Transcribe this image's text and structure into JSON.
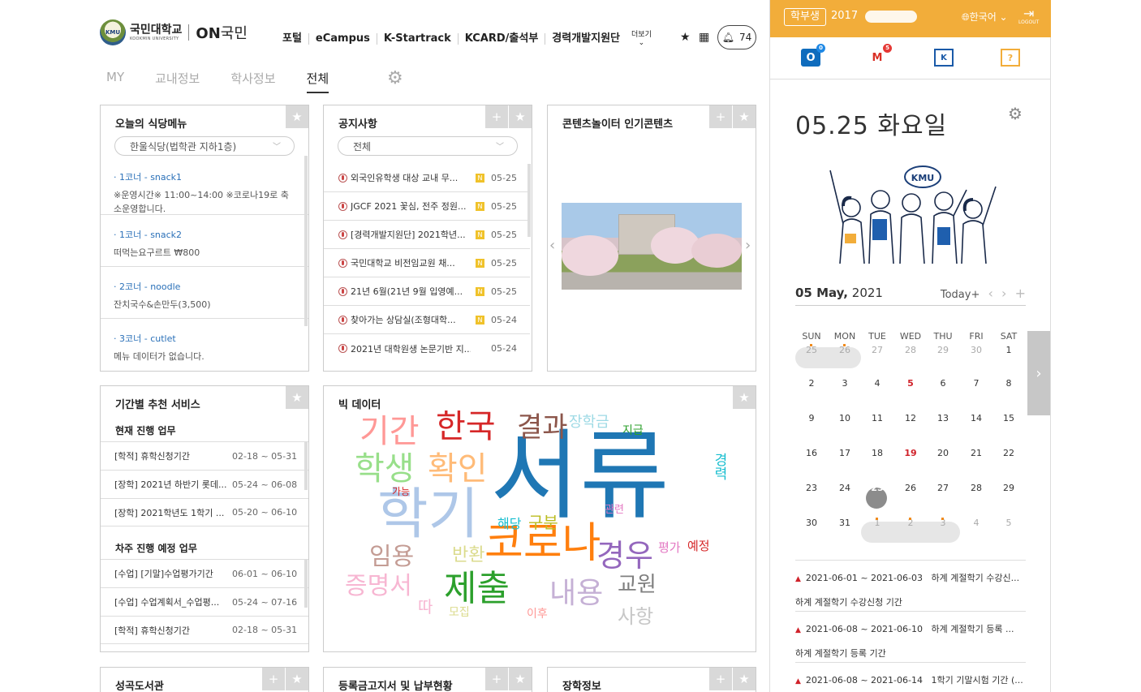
{
  "header": {
    "logo_ko": "국민대학교",
    "logo_en": "KOOKMIN UNIVERSITY",
    "logo_emblem": "KMU",
    "brand_on": "ON",
    "brand_kook": "국민",
    "nav": [
      "포털",
      "eCampus",
      "K-Startrack",
      "KCARD/출석부",
      "경력개발지원단"
    ],
    "more": "더보기",
    "notif_count": "74"
  },
  "tabs": [
    "MY",
    "교내정보",
    "학사정보",
    "전체"
  ],
  "active_tab": "전체",
  "meal": {
    "title": "오늘의 식당메뉴",
    "select": "한울식당(법학관 지하1층)",
    "items": [
      {
        "name": "· 1코너 - snack1",
        "desc": "※운영시간※ 11:00~14:00 ※코로나19로 축소운영합니다."
      },
      {
        "name": "· 1코너 - snack2",
        "desc": "떠먹는요구르트 ₩800"
      },
      {
        "name": "· 2코너 - noodle",
        "desc": "잔치국수&손만두(3,500)"
      },
      {
        "name": "· 3코너 - cutlet",
        "desc": "메뉴 데이터가 없습니다."
      }
    ]
  },
  "notice": {
    "title": "공지사항",
    "select": "전체",
    "badge": "N",
    "items": [
      {
        "text": "외국인유학생 대상 교내 무...",
        "date": "05-25"
      },
      {
        "text": "JGCF 2021 꽃심, 전주 정원...",
        "date": "05-25"
      },
      {
        "text": "[경력개발지원단] 2021학년...",
        "date": "05-25"
      },
      {
        "text": "국민대학교 비전임교원 채...",
        "date": "05-25"
      },
      {
        "text": "21년 6월(21년 9월 입영예...",
        "date": "05-25"
      },
      {
        "text": "찾아가는 상담실(조형대학...",
        "date": "05-24"
      },
      {
        "text": "2021년 대학원생 논문기반 지...",
        "date": "05-24"
      }
    ]
  },
  "content": {
    "title": "콘텐츠놀이터 인기콘텐츠"
  },
  "recommend": {
    "title": "기간별 추천 서비스",
    "current_label": "현재 진행 업무",
    "current": [
      {
        "text": "[학적] 휴학신청기간",
        "date": "02-18 ~ 05-31"
      },
      {
        "text": "[장학] 2021년 하반기 롯데...",
        "date": "05-24 ~ 06-08"
      },
      {
        "text": "[장학] 2021학년도 1학기 ...",
        "date": "05-20 ~ 06-10"
      }
    ],
    "next_label": "차주 진행 예정 업무",
    "next": [
      {
        "text": "[수업] [기말]수업평가기간",
        "date": "06-01 ~ 06-10"
      },
      {
        "text": "[수업] 수업계획서_수업평...",
        "date": "05-24 ~ 07-16"
      },
      {
        "text": "[학적] 휴학신청기간",
        "date": "02-18 ~ 05-31"
      }
    ]
  },
  "bigdata": {
    "title": "빅 데이터",
    "words": [
      "서류",
      "학기",
      "코로나",
      "한국",
      "기간",
      "학생",
      "확인",
      "결과",
      "제출",
      "장학금",
      "지급",
      "경우",
      "내용",
      "증명서",
      "임용",
      "교원",
      "사항",
      "반환",
      "구분",
      "해당",
      "평가",
      "예정",
      "경력",
      "관련",
      "이후",
      "모집",
      "가능",
      "따"
    ]
  },
  "bottom_panels": [
    "성곡도서관",
    "등록금고지서 및 납부현황",
    "장학정보"
  ],
  "side": {
    "role": "학부생",
    "student_id": "2017",
    "lang": "한국어",
    "logout": "LOGOUT",
    "quick_badges": [
      "0",
      "5"
    ],
    "date_title": "05.25 화요일",
    "kmu_bubble": "KMU",
    "cal_month": "05 May,",
    "cal_year": "2021",
    "today_btn": "Today+",
    "weekdays": [
      "SUN",
      "MON",
      "TUE",
      "WED",
      "THU",
      "FRI",
      "SAT"
    ],
    "weeks": [
      [
        "25",
        "26",
        "27",
        "28",
        "29",
        "30",
        "1"
      ],
      [
        "2",
        "3",
        "4",
        "5",
        "6",
        "7",
        "8"
      ],
      [
        "9",
        "10",
        "11",
        "12",
        "13",
        "14",
        "15"
      ],
      [
        "16",
        "17",
        "18",
        "19",
        "20",
        "21",
        "22"
      ],
      [
        "23",
        "24",
        "25",
        "26",
        "27",
        "28",
        "29"
      ],
      [
        "30",
        "31",
        "1",
        "2",
        "3",
        "4",
        "5"
      ]
    ],
    "events": [
      {
        "range": "2021-06-01 ~ 2021-06-03",
        "title": "하계 계절학기 수강신...",
        "desc": "하계 계절학기 수강신청 기간"
      },
      {
        "range": "2021-06-08 ~ 2021-06-10",
        "title": "하계 계절학기 등록 ...",
        "desc": "하계 계절학기 등록 기간"
      },
      {
        "range": "2021-06-08 ~ 2021-06-14",
        "title": "1학기 기말시험 기간 (...",
        "desc": ""
      }
    ]
  },
  "colors": {
    "accent": "#f2ad3a",
    "brand_blue": "#2a70b8",
    "holiday_red": "#d0222a"
  }
}
